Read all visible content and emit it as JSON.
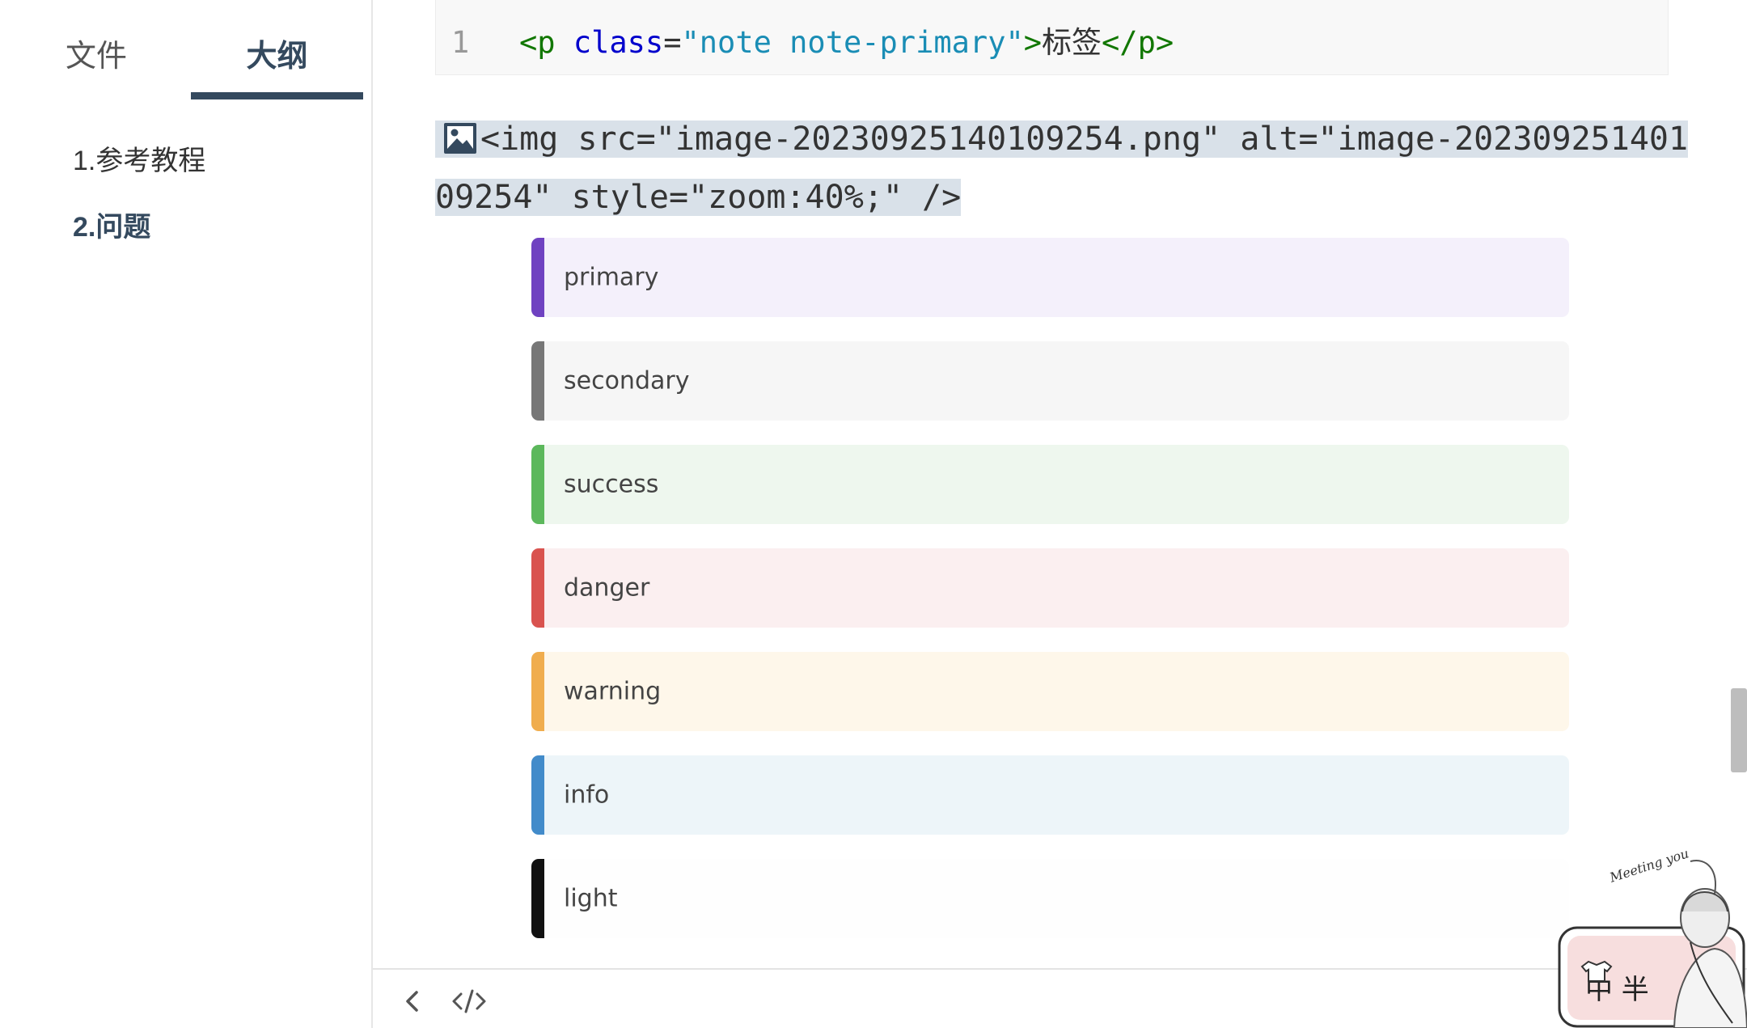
{
  "sidebar": {
    "tabs": [
      {
        "label": "文件",
        "active": false
      },
      {
        "label": "大纲",
        "active": true
      }
    ],
    "outline": [
      {
        "label": "1.参考教程"
      },
      {
        "label": "2.问题"
      }
    ]
  },
  "editor": {
    "code_block": {
      "line_number": "1",
      "tokens": {
        "open_tag": "<p ",
        "attr": "class",
        "eq": "=",
        "value": "\"note note-primary\"",
        "close_open": ">",
        "text": "标签",
        "end_tag": "</p>"
      }
    },
    "image_source_text": "<img src=\"image-20230925140109254.png\" alt=\"image-20230925140109254\" style=\"zoom:40%;\" />",
    "notes": [
      {
        "label": "primary",
        "border": "#6f42c1",
        "background": "#f4f0fb"
      },
      {
        "label": "secondary",
        "border": "#777777",
        "background": "#f6f6f6"
      },
      {
        "label": "success",
        "border": "#5cb85c",
        "background": "#eef7ee"
      },
      {
        "label": "danger",
        "border": "#d9534f",
        "background": "#fbeff0"
      },
      {
        "label": "warning",
        "border": "#f0ad4e",
        "background": "#fef7ea"
      },
      {
        "label": "info",
        "border": "#428bca",
        "background": "#edf5f9"
      },
      {
        "label": "light",
        "border": "#111111",
        "background": "#fefefe"
      }
    ]
  },
  "footer": {
    "icons": [
      "chevron-left-icon",
      "code-icon"
    ]
  },
  "mascot": {
    "icon": "girl-mascot-icon",
    "caption": "中 半",
    "greeting": "Meeting you"
  },
  "colors": {
    "accent": "#34495e",
    "selection": "#d9e1e9"
  }
}
